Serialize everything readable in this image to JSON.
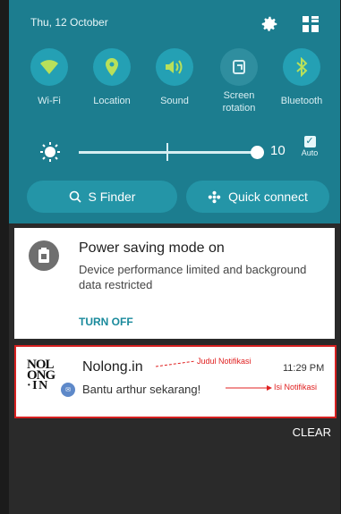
{
  "header": {
    "date": "Thu, 12 October"
  },
  "quick_toggles": [
    {
      "label": "Wi-Fi",
      "icon": "wifi-icon"
    },
    {
      "label": "Location",
      "icon": "location-pin-icon"
    },
    {
      "label": "Sound",
      "icon": "sound-icon"
    },
    {
      "label": "Screen rotation",
      "icon": "screen-rotation-icon"
    },
    {
      "label": "Bluetooth",
      "icon": "bluetooth-icon"
    }
  ],
  "brightness": {
    "value": "10",
    "auto_label": "Auto",
    "auto_checked": true
  },
  "actions": {
    "s_finder": "S Finder",
    "quick_connect": "Quick connect"
  },
  "notifications": [
    {
      "app": "Power saving",
      "title": "Power saving mode on",
      "text": "Device performance limited and background data restricted",
      "action": "TURN OFF"
    },
    {
      "app": "Nolong.in",
      "title": "Nolong.in",
      "text": "Bantu arthur sekarang!",
      "time": "11:29 PM",
      "annotation_title": "Judul Notifikasi",
      "annotation_text": "Isi Notifikasi",
      "logo_lines": [
        "NOL",
        "ONG",
        "· I N"
      ]
    }
  ],
  "footer": {
    "clear": "CLEAR"
  },
  "colors": {
    "panel": "#1c7d8f",
    "toggle_on": "#24a0b4",
    "action_teal": "#1a8a9c",
    "annotation_red": "#d62020"
  }
}
